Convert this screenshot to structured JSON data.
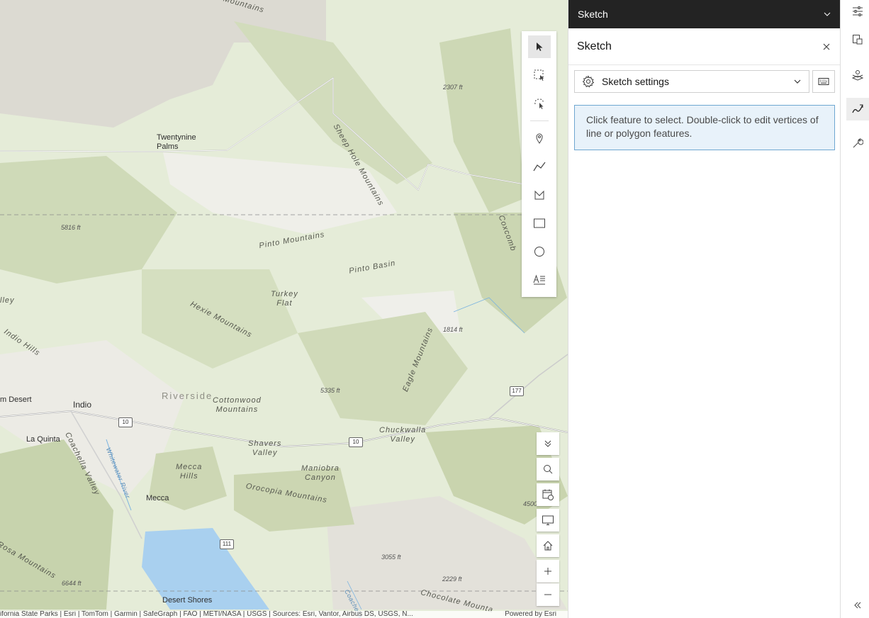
{
  "map": {
    "places": {
      "twentynine_palms": "Twentynine\nPalms",
      "indio": "Indio",
      "palm_desert": "m Desert",
      "la_quinta": "La Quinta",
      "mecca": "Mecca",
      "desert_shores": "Desert Shores",
      "riverside": "Riverside"
    },
    "features": {
      "mountains_top": "un Mountains",
      "sheep_hole": "Sheep Hole Mountains",
      "coxcomb": "Coxcomb",
      "pinto_mountains": "Pinto Mountains",
      "pinto_basin": "Pinto Basin",
      "turkey_flat": "Turkey\nFlat",
      "hexie": "Hexie Mountains",
      "valley_left": "lley",
      "indio_hills": "Indio Hills",
      "eagle": "Eagle Mountains",
      "cottonwood": "Cottonwood\nMountains",
      "chuckwalla": "Chuckwalla\nValley",
      "shavers": "Shavers\nValley",
      "coachella": "Coachella Valley",
      "mecca_hills": "Mecca\nHills",
      "maniobra": "Maniobra\nCanyon",
      "orocopia": "Orocopia Mountains",
      "rosa": "Rosa Mountains",
      "chocolate": "Chocolate Mounta",
      "whitewater": "Whitewater River",
      "coachella_canal": "Coachella"
    },
    "elevations": [
      "2307 ft",
      "5816 ft",
      "1814 ft",
      "5335 ft",
      "4500",
      "3055 ft",
      "2229 ft",
      "6644 ft"
    ],
    "shields": [
      "10",
      "10",
      "177",
      "111"
    ],
    "attribution": "ifornia State Parks | Esri | TomTom | Garmin | SafeGraph | FAO | METI/NASA | USGS | Sources: Esri, Vantor, Airbus DS, USGS, N...",
    "powered_by": "Powered by Esri"
  },
  "panel": {
    "header_title": "Sketch",
    "sketch_title": "Sketch",
    "settings_label": "Sketch settings",
    "notice": "Click feature to select. Double-click to edit vertices of line or polygon features."
  },
  "toolbar": {
    "tools": [
      "select-icon",
      "rectangle-select-icon",
      "lasso-select-icon",
      "point-icon",
      "polyline-icon",
      "polygon-icon",
      "rectangle-icon",
      "circle-icon",
      "text-icon"
    ]
  },
  "nav": [
    "collapse-icon",
    "search-icon",
    "layer-list-icon",
    "screen-icon",
    "home-icon",
    "zoom-in-icon",
    "zoom-out-icon"
  ],
  "rail": [
    "settings-sliders-icon",
    "legend-icon",
    "basemap-icon",
    "sketch-icon",
    "tools-wrench-icon",
    "collapse-panel-icon"
  ]
}
